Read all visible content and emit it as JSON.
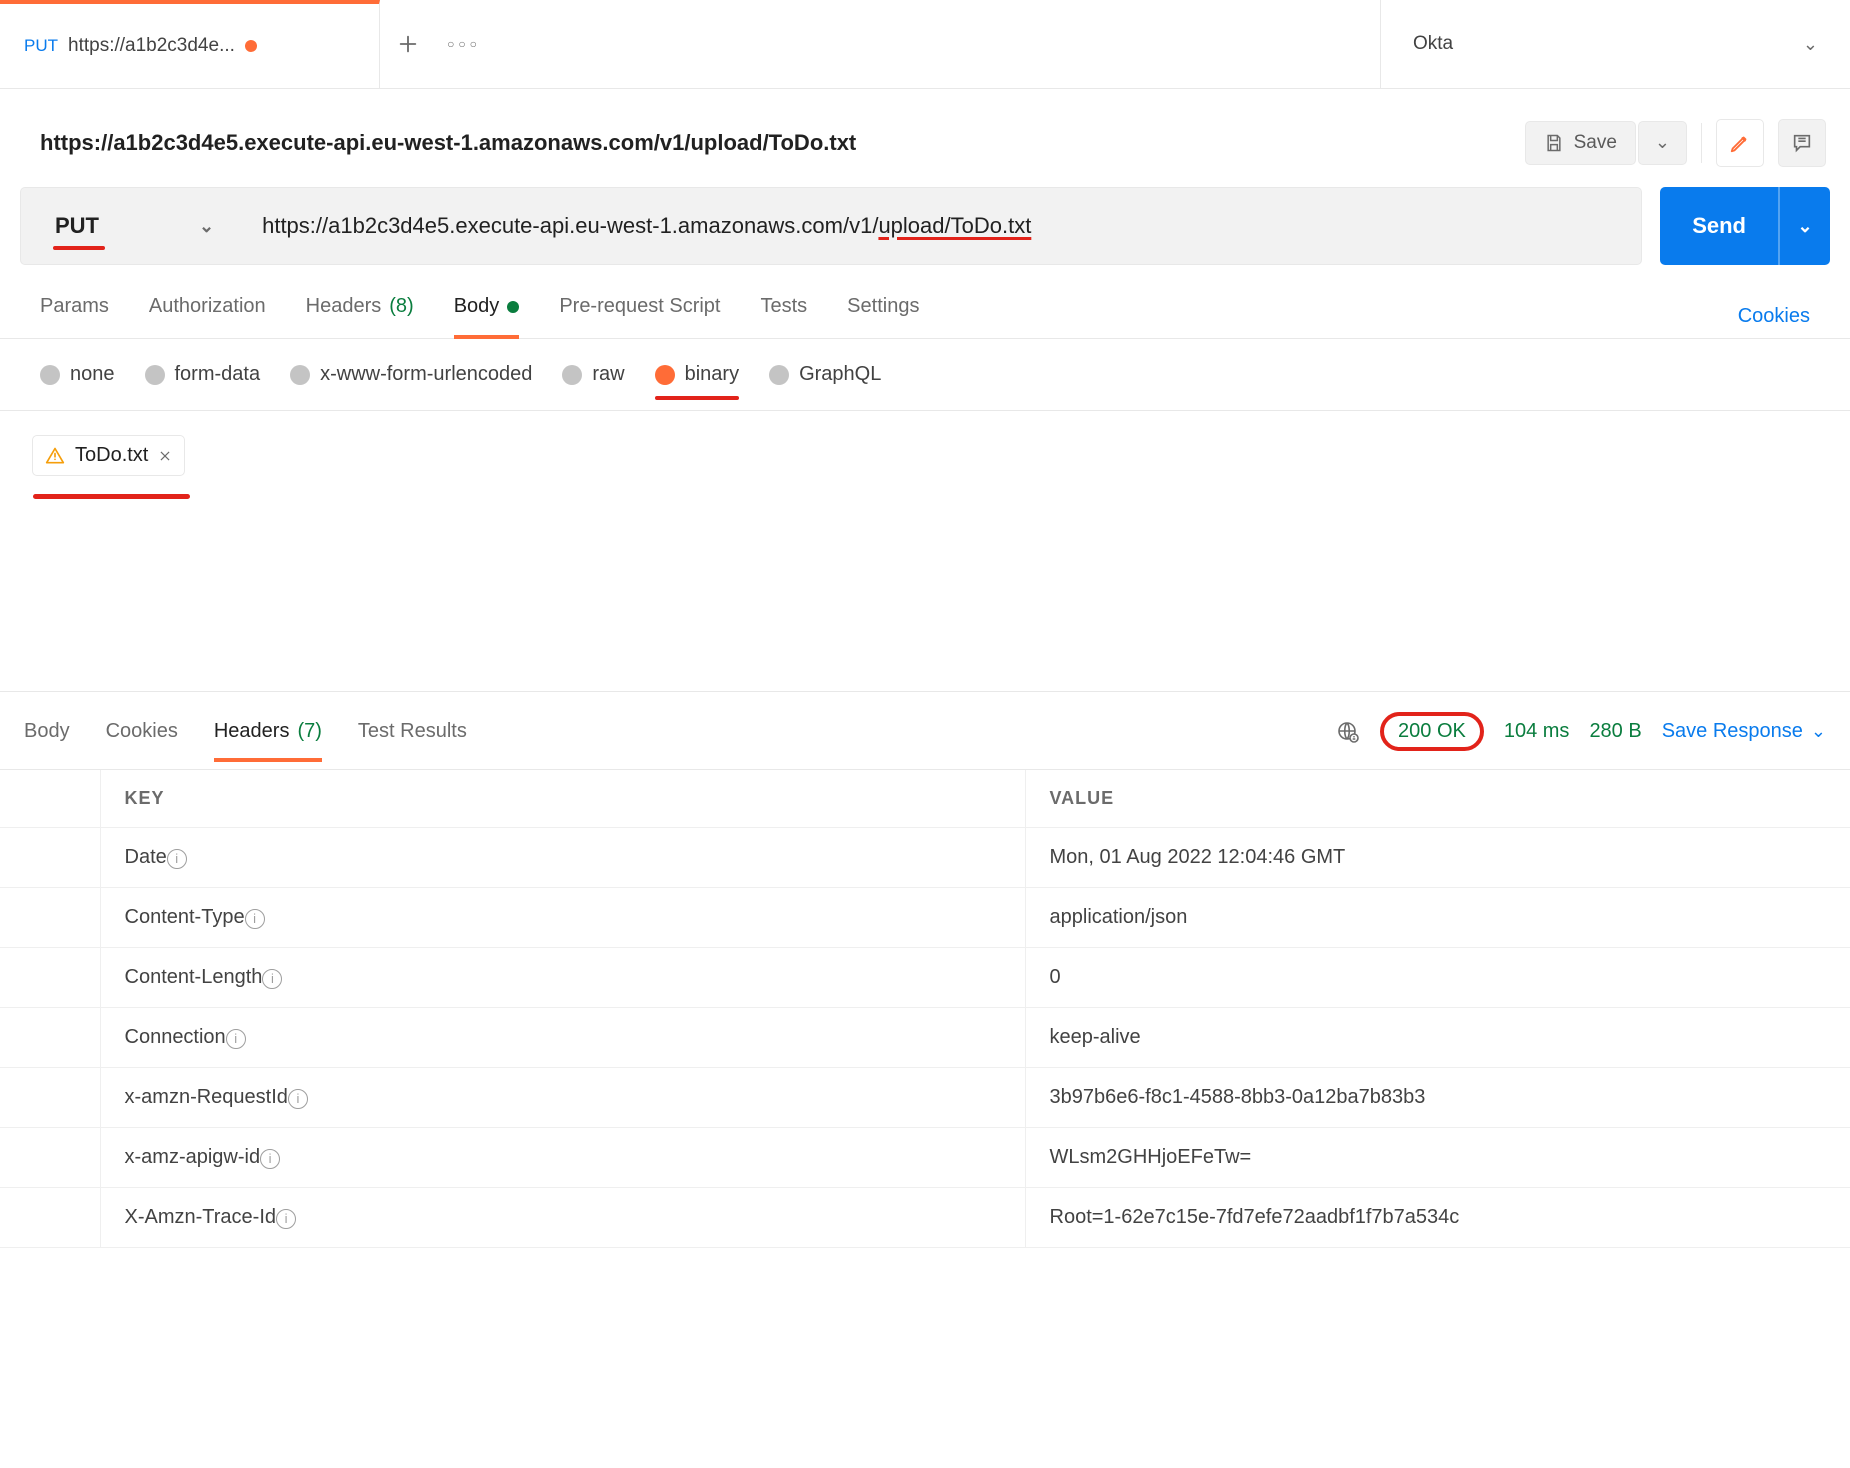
{
  "tab": {
    "method": "PUT",
    "title": "https://a1b2c3d4e...",
    "unsaved": true
  },
  "env": {
    "name": "Okta"
  },
  "breadcrumb": "https://a1b2c3d4e5.execute-api.eu-west-1.amazonaws.com/v1/upload/ToDo.txt",
  "save_label": "Save",
  "request": {
    "method": "PUT",
    "url_pre": "https://a1b2c3d4e5.execute-api.eu-west-1.amazonaws.com/v1/",
    "url_highlight": "upload/ToDo.txt",
    "send_label": "Send"
  },
  "sectionTabs": {
    "params": "Params",
    "auth": "Authorization",
    "headers": "Headers",
    "headers_count": "(8)",
    "body": "Body",
    "prereq": "Pre-request Script",
    "tests": "Tests",
    "settings": "Settings",
    "cookies": "Cookies"
  },
  "bodyTypes": {
    "none": "none",
    "formdata": "form-data",
    "urlencoded": "x-www-form-urlencoded",
    "raw": "raw",
    "binary": "binary",
    "graphql": "GraphQL"
  },
  "file_chip": "ToDo.txt",
  "responseTabs": {
    "body": "Body",
    "cookies": "Cookies",
    "headers": "Headers",
    "headers_count": "(7)",
    "testresults": "Test Results"
  },
  "response_meta": {
    "status": "200 OK",
    "time": "104 ms",
    "size": "280 B",
    "save": "Save Response"
  },
  "table_headers": {
    "key": "KEY",
    "value": "VALUE"
  },
  "headers": [
    {
      "k": "Date",
      "v": "Mon, 01 Aug 2022 12:04:46 GMT"
    },
    {
      "k": "Content-Type",
      "v": "application/json"
    },
    {
      "k": "Content-Length",
      "v": "0"
    },
    {
      "k": "Connection",
      "v": "keep-alive"
    },
    {
      "k": "x-amzn-RequestId",
      "v": "3b97b6e6-f8c1-4588-8bb3-0a12ba7b83b3"
    },
    {
      "k": "x-amz-apigw-id",
      "v": "WLsm2GHHjoEFeTw="
    },
    {
      "k": "X-Amzn-Trace-Id",
      "v": "Root=1-62e7c15e-7fd7efe72aadbf1f7b7a534c"
    }
  ]
}
